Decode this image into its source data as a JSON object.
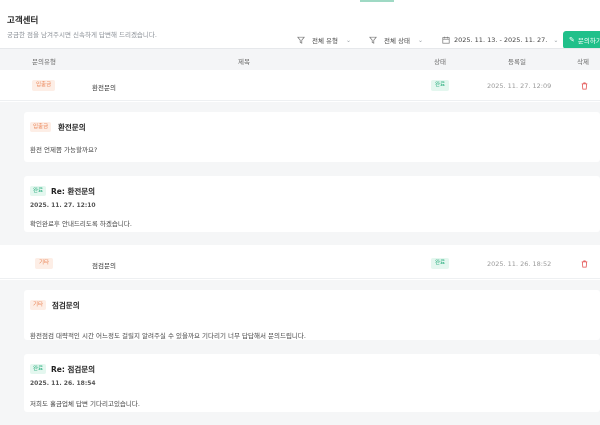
{
  "header": {
    "title": "고객센터",
    "subtitle": "궁금한 점을 남겨주시면 신속하게 답변해 드리겠습니다."
  },
  "filters": {
    "type": "전체 유형",
    "status": "전체 상태",
    "date_range": "2025. 11. 13. - 2025. 11. 27."
  },
  "inquiry_button": "문의하기",
  "table": {
    "columns": [
      "문의유형",
      "제목",
      "상태",
      "등록일",
      "삭제"
    ]
  },
  "rows": [
    {
      "type": "입출금",
      "title": "환전문의",
      "status": "완료",
      "date": "2025. 11. 27. 12:09"
    },
    {
      "type": "기타",
      "title": "점검문의",
      "status": "완료",
      "date": "2025. 11. 26. 18:52"
    }
  ],
  "threads": [
    {
      "question": {
        "badge": "입출금",
        "title": "환전문의",
        "body": "환전 언제쯤 가능할까요?"
      },
      "answer": {
        "badge": "완료",
        "title": "Re: 환전문의",
        "date": "2025. 11. 27. 12:10",
        "body": "확인완료후 안내드리도록 하겠습니다."
      }
    },
    {
      "question": {
        "badge": "기타",
        "title": "점검문의",
        "body": "환전점검 대략적인 시간 어느정도 걸릴지 알려주실 수 있을까요 기다리기 너무 답답해서 문의드립니다."
      },
      "answer": {
        "badge": "완료",
        "title": "Re: 점검문의",
        "date": "2025. 11. 26. 18:54",
        "body": "저희도 홀금업체 답변 기다리고있습니다."
      }
    }
  ],
  "colors": {
    "accent": "#20c08a",
    "badge_green_bg": "#e4f7ef",
    "badge_green_fg": "#1aa774",
    "badge_orange_bg": "#fdeee6",
    "badge_orange_fg": "#e98050",
    "delete": "#e24b4b",
    "panel_bg": "#f5f6f7"
  }
}
